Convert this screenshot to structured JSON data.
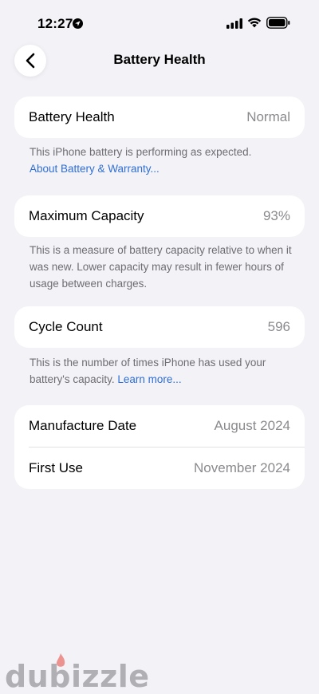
{
  "status_bar": {
    "time": "12:27",
    "icons": [
      "location-icon",
      "signal-icon",
      "wifi-icon",
      "battery-icon"
    ]
  },
  "nav": {
    "title": "Battery Health",
    "back_icon": "chevron-left-icon"
  },
  "battery_health": {
    "label": "Battery Health",
    "value": "Normal",
    "note": "This iPhone battery is performing as expected.",
    "link": "About Battery & Warranty..."
  },
  "maximum_capacity": {
    "label": "Maximum Capacity",
    "value": "93%",
    "note": "This is a measure of battery capacity relative to when it was new. Lower capacity may result in fewer hours of usage between charges."
  },
  "cycle_count": {
    "label": "Cycle Count",
    "value": "596",
    "note": "This is the number of times iPhone has used your battery's capacity.",
    "link": "Learn more..."
  },
  "dates": {
    "manufacture_label": "Manufacture Date",
    "manufacture_value": "August 2024",
    "first_use_label": "First Use",
    "first_use_value": "November 2024"
  },
  "watermark": {
    "text": "dubizzle"
  },
  "colors": {
    "background": "#f2f2f7",
    "card": "#ffffff",
    "secondary_text": "#8a8a8e",
    "link": "#2f6fd6"
  }
}
